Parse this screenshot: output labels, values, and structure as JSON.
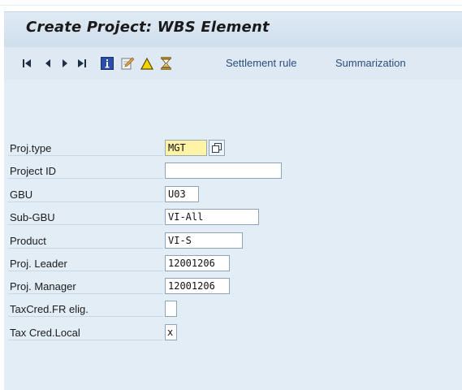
{
  "window": {
    "title": "Create Project: WBS Element"
  },
  "toolbar": {
    "nav_first_icon": "first-page-icon",
    "nav_prev_icon": "previous-page-icon",
    "nav_next_icon": "next-page-icon",
    "nav_last_icon": "last-page-icon",
    "info_icon": "information-icon",
    "edit_icon": "edit-pencil-icon",
    "warning_icon": "warning-triangle-icon",
    "hourglass_icon": "hourglass-icon",
    "settlement_rule_label": "Settlement rule",
    "summarization_label": "Summarization"
  },
  "form": {
    "fields": [
      {
        "label": "Proj.type",
        "value": "MGT"
      },
      {
        "label": "Project ID",
        "value": ""
      },
      {
        "label": "GBU",
        "value": "U03"
      },
      {
        "label": "Sub-GBU",
        "value": "VI-All"
      },
      {
        "label": "Product",
        "value": "VI-S"
      },
      {
        "label": "Proj. Leader",
        "value": "12001206"
      },
      {
        "label": "Proj. Manager",
        "value": "12001206"
      },
      {
        "label": "TaxCred.FR elig.",
        "value": ""
      },
      {
        "label": "Tax Cred.Local",
        "value": "x"
      }
    ]
  },
  "colors": {
    "title_bar": "#d3e1ee",
    "content_bg": "#e3edf6",
    "required_field": "#fff3a6",
    "link_text": "#2b4f7e"
  }
}
